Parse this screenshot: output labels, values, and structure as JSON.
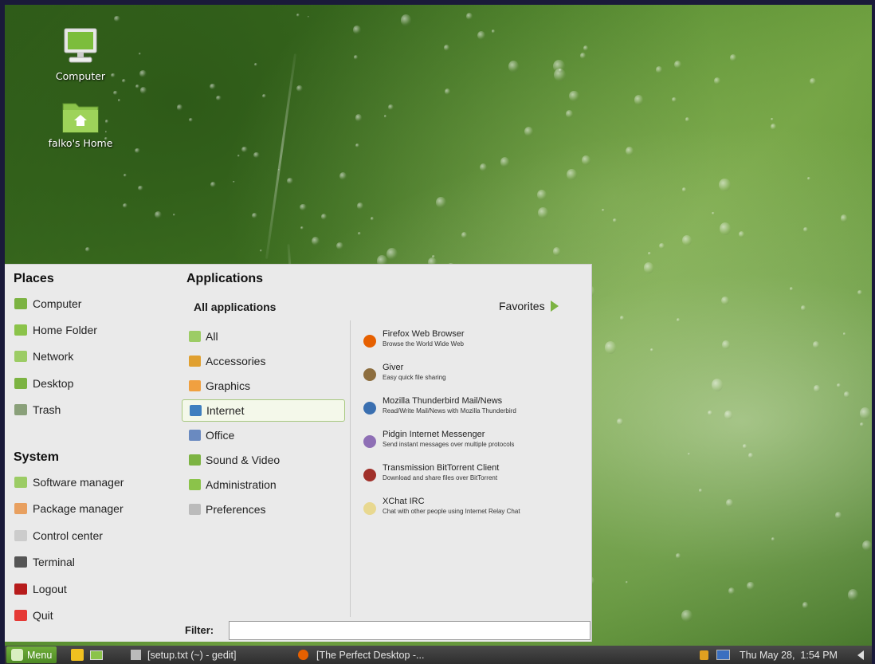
{
  "desktop": {
    "icons": [
      {
        "label": "Computer",
        "icon": "monitor-icon"
      },
      {
        "label": "falko's Home",
        "icon": "home-folder-icon"
      }
    ]
  },
  "menu": {
    "places_title": "Places",
    "places": [
      {
        "label": "Computer",
        "icon": "computer-icon",
        "color": "#7cb342"
      },
      {
        "label": "Home Folder",
        "icon": "folder-icon",
        "color": "#8bc34a"
      },
      {
        "label": "Network",
        "icon": "network-icon",
        "color": "#9ccc65"
      },
      {
        "label": "Desktop",
        "icon": "desktop-icon",
        "color": "#7cb342"
      },
      {
        "label": "Trash",
        "icon": "trash-icon",
        "color": "#8aa07a"
      }
    ],
    "system_title": "System",
    "system": [
      {
        "label": "Software manager",
        "icon": "software-manager-icon",
        "color": "#9ccc65"
      },
      {
        "label": "Package manager",
        "icon": "package-manager-icon",
        "color": "#e8a060"
      },
      {
        "label": "Control center",
        "icon": "control-center-icon",
        "color": "#cccccc"
      },
      {
        "label": "Terminal",
        "icon": "terminal-icon",
        "color": "#555555"
      },
      {
        "label": "Logout",
        "icon": "logout-icon",
        "color": "#b71c1c"
      },
      {
        "label": "Quit",
        "icon": "quit-icon",
        "color": "#e53935"
      }
    ],
    "applications_title": "Applications",
    "all_applications": "All applications",
    "favorites": "Favorites",
    "categories": [
      {
        "label": "All",
        "icon": "all-icon",
        "color": "#9ccc65"
      },
      {
        "label": "Accessories",
        "icon": "accessories-icon",
        "color": "#e0a030"
      },
      {
        "label": "Graphics",
        "icon": "graphics-icon",
        "color": "#f0a040"
      },
      {
        "label": "Internet",
        "icon": "internet-icon",
        "color": "#3f7fbf"
      },
      {
        "label": "Office",
        "icon": "office-icon",
        "color": "#6a8ac0"
      },
      {
        "label": "Sound & Video",
        "icon": "sound-video-icon",
        "color": "#7cb342"
      },
      {
        "label": "Administration",
        "icon": "administration-icon",
        "color": "#8bc34a"
      },
      {
        "label": "Preferences",
        "icon": "preferences-icon",
        "color": "#bbbbbb"
      }
    ],
    "apps": [
      {
        "name": "Firefox Web Browser",
        "desc": "Browse the World Wide Web",
        "icon": "firefox-icon",
        "color": "#e66000"
      },
      {
        "name": "Giver",
        "desc": "Easy quick file sharing",
        "icon": "giver-icon",
        "color": "#8d6e3f"
      },
      {
        "name": "Mozilla Thunderbird Mail/News",
        "desc": "Read/Write Mail/News with Mozilla Thunderbird",
        "icon": "thunderbird-icon",
        "color": "#3a6fb0"
      },
      {
        "name": "Pidgin Internet Messenger",
        "desc": "Send instant messages over multiple protocols",
        "icon": "pidgin-icon",
        "color": "#8e6fb5"
      },
      {
        "name": "Transmission BitTorrent Client",
        "desc": "Download and share files over BitTorrent",
        "icon": "transmission-icon",
        "color": "#a0302a"
      },
      {
        "name": "XChat IRC",
        "desc": "Chat with other people using Internet Relay Chat",
        "icon": "xchat-icon",
        "color": "#e8d890"
      }
    ],
    "filter_label": "Filter:",
    "filter_value": ""
  },
  "taskbar": {
    "menu_label": "Menu",
    "windows": [
      {
        "label": "[setup.txt (~) - gedit]",
        "icon": "gedit-icon"
      },
      {
        "label": "[The Perfect Desktop -...",
        "icon": "firefox-icon"
      }
    ],
    "clock": "Thu May 28,  1:54 PM"
  }
}
